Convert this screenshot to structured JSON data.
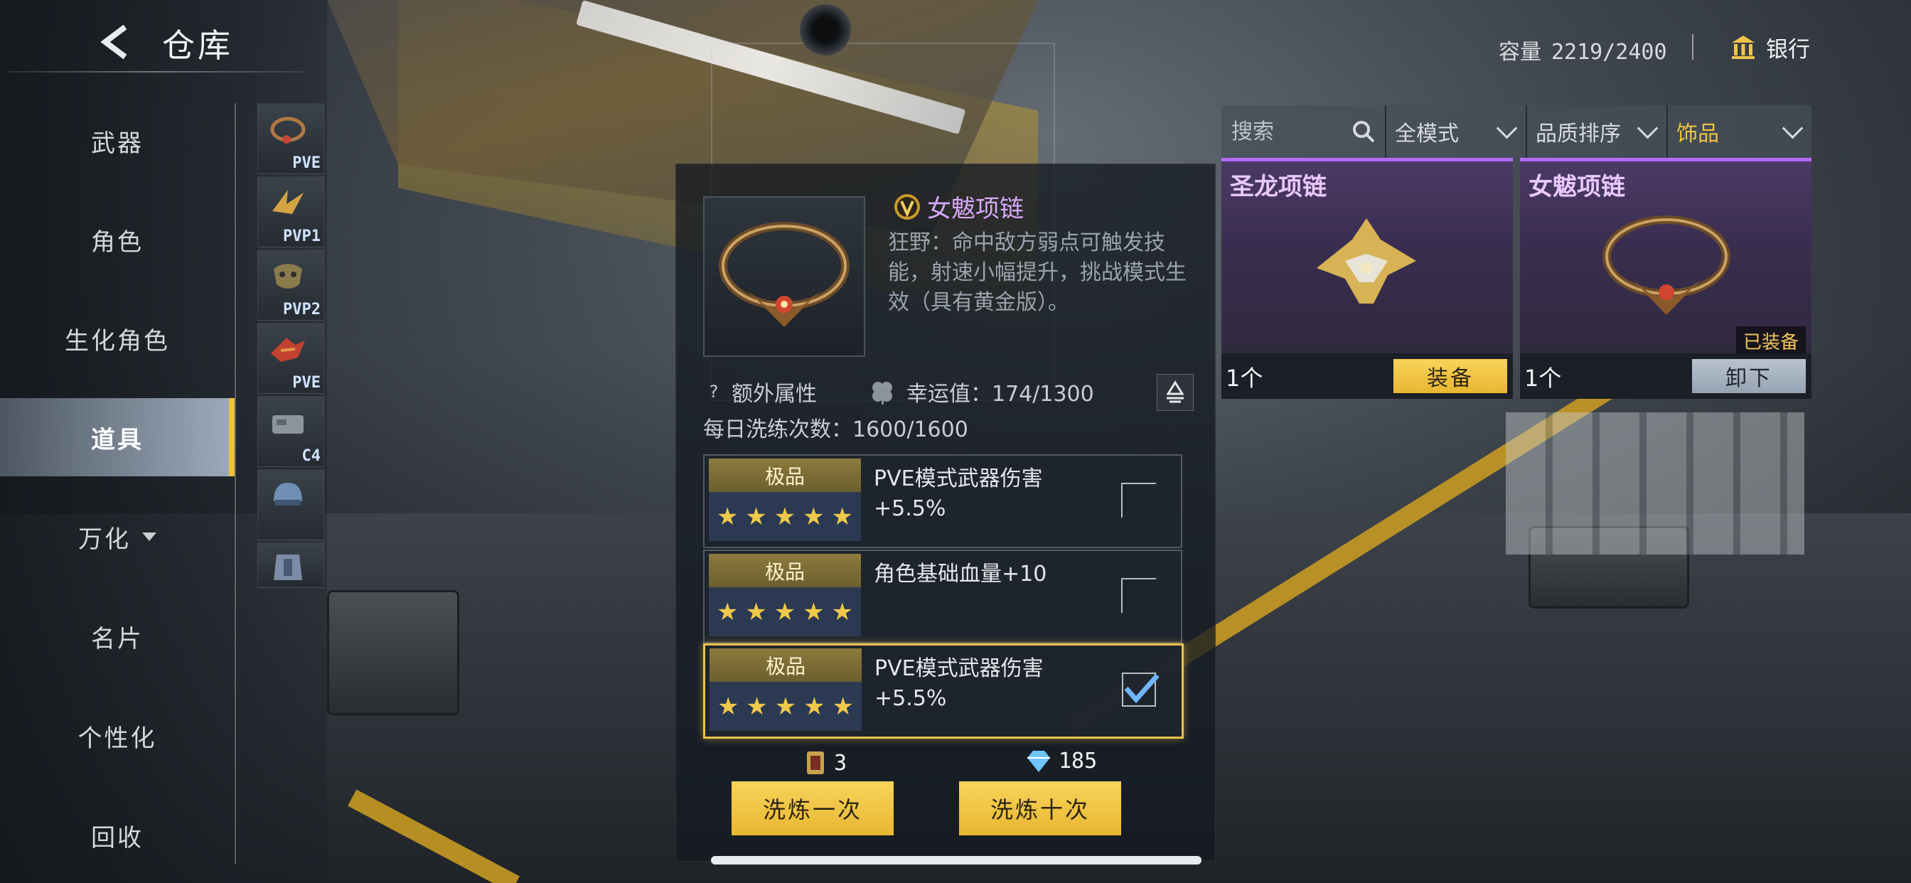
{
  "header": {
    "title": "仓库",
    "capacity_label": "容量",
    "capacity_value": "2219/2400",
    "bank_label": "银行"
  },
  "sidebar": {
    "categories": [
      {
        "label": "武器"
      },
      {
        "label": "角色"
      },
      {
        "label": "生化角色"
      },
      {
        "label": "道具",
        "active": true
      },
      {
        "label": "万化"
      },
      {
        "label": "名片"
      },
      {
        "label": "个性化"
      },
      {
        "label": "回收"
      }
    ],
    "thumbs": [
      {
        "tag": "PVE",
        "icon": "necklace-icon"
      },
      {
        "tag": "PVP1",
        "icon": "golden-wings-icon"
      },
      {
        "tag": "PVP2",
        "icon": "mask-icon"
      },
      {
        "tag": "PVE",
        "icon": "red-dragon-icon"
      },
      {
        "tag": "C4",
        "icon": "c4-icon"
      },
      {
        "tag": "",
        "icon": "helmet-icon"
      },
      {
        "tag": "",
        "icon": "armor-icon"
      }
    ]
  },
  "detail": {
    "item_name": "女魃项链",
    "description": "狂野：命中敌方弱点可触发技能，射速小幅提升，挑战模式生效（具有黄金版）。",
    "extra_attr_label": "额外属性",
    "luck_label": "幸运值：174/1300",
    "daily_refine": "每日洗练次数：1600/1600",
    "rolls": [
      {
        "grade": "极品",
        "stars": 5,
        "text": "PVE模式武器伤害+5.5%",
        "selected": false
      },
      {
        "grade": "极品",
        "stars": 5,
        "text": "角色基础血量+10",
        "selected": false
      },
      {
        "grade": "极品",
        "stars": 5,
        "text": "PVE模式武器伤害+5.5%",
        "selected": true
      }
    ],
    "cost_scroll": "3",
    "cost_diamond": "185",
    "btn_once": "洗炼一次",
    "btn_ten": "洗炼十次"
  },
  "inventory": {
    "search_placeholder": "搜索",
    "mode_filter": "全模式",
    "sort_filter": "品质排序",
    "type_filter": "饰品",
    "items": [
      {
        "name": "圣龙项链",
        "count": "1个",
        "button": "装备",
        "equipped": false
      },
      {
        "name": "女魃项链",
        "count": "1个",
        "button": "卸下",
        "equipped": true,
        "equipped_tag": "已装备"
      }
    ]
  },
  "colors": {
    "accent_gold": "#e9b631",
    "legendary_purple": "#b36cff",
    "active_tab": "#c8d7eb"
  }
}
